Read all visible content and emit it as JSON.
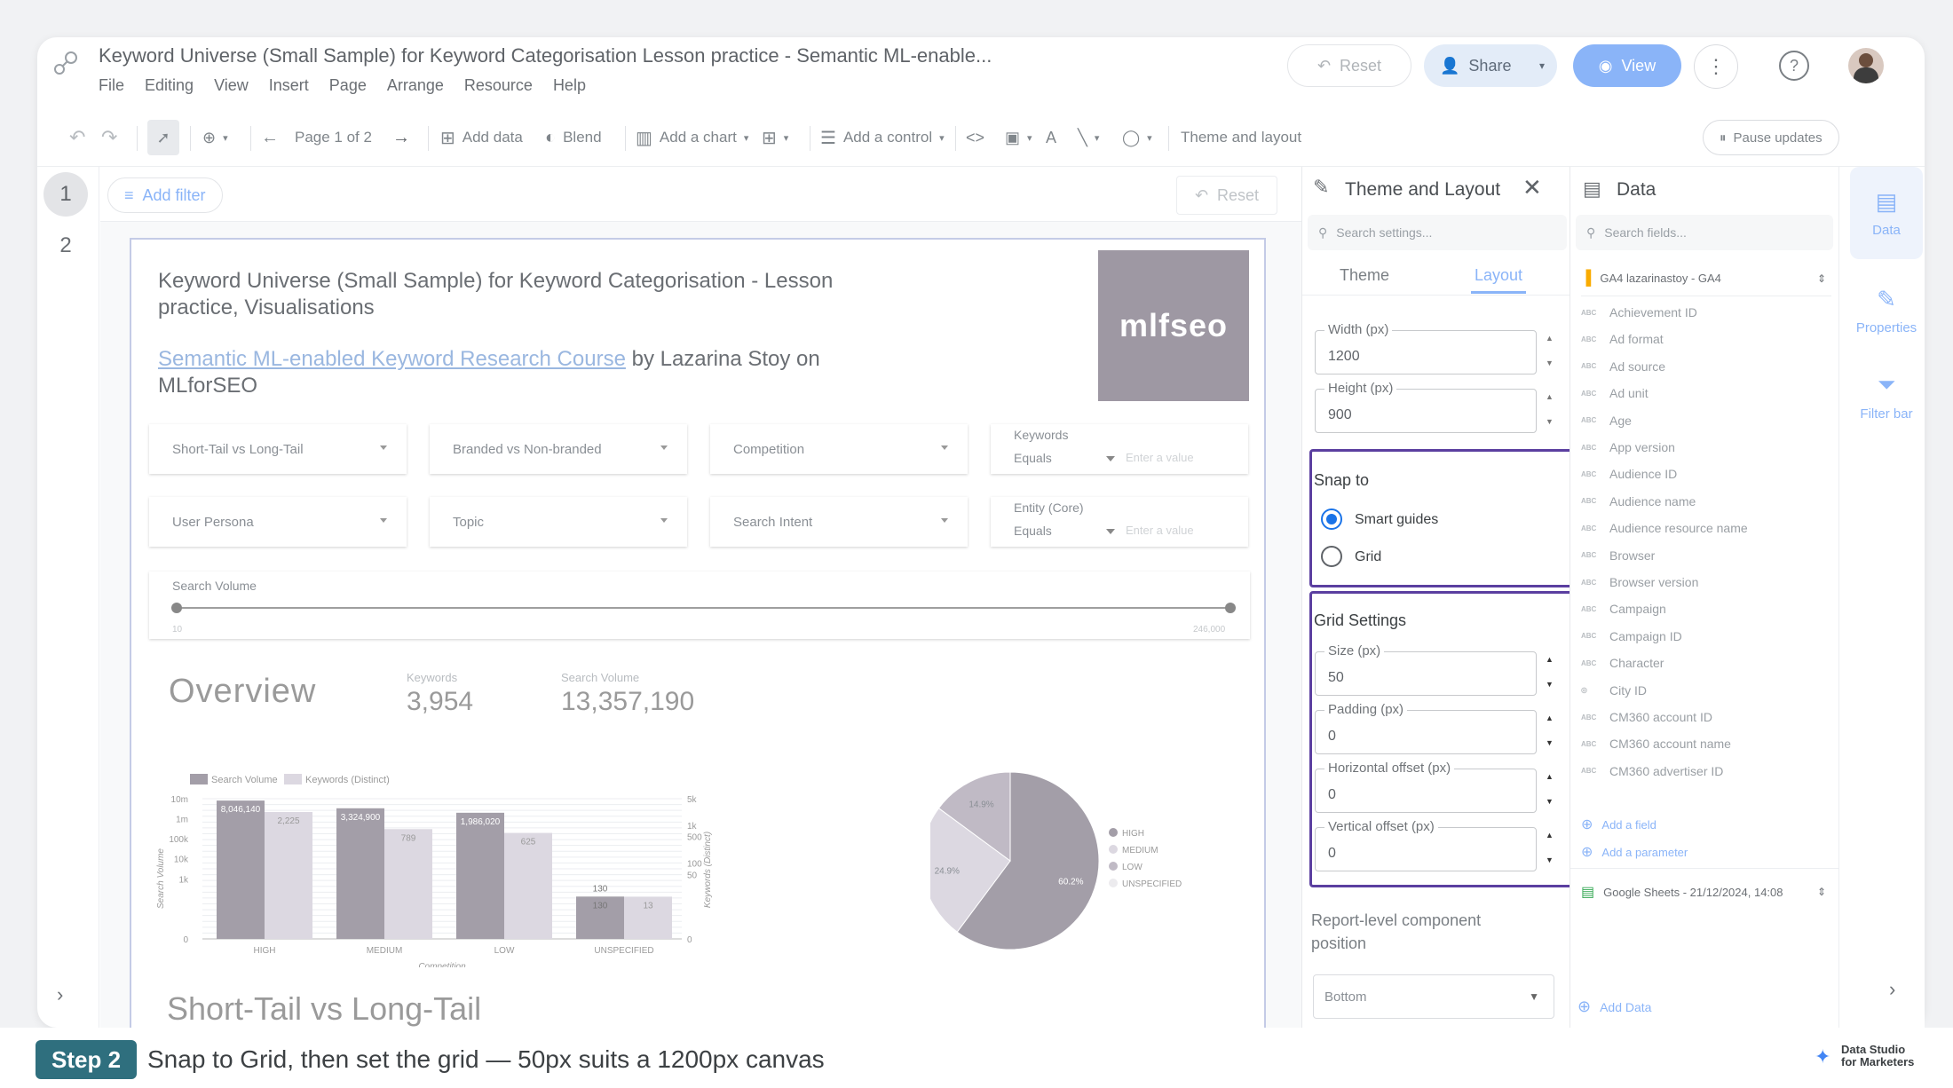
{
  "window": {
    "title": "Keyword Universe (Small Sample) for Keyword Categorisation Lesson practice - Semantic ML-enable...",
    "menu": [
      "File",
      "Editing",
      "View",
      "Insert",
      "Page",
      "Arrange",
      "Resource",
      "Help"
    ],
    "reset_label": "Reset",
    "share_label": "Share",
    "view_label": "View"
  },
  "toolbar": {
    "page_label": "Page 1 of 2",
    "add_data": "Add data",
    "blend": "Blend",
    "add_chart": "Add a chart",
    "add_control": "Add a control",
    "theme_layout": "Theme and layout",
    "pause_updates": "Pause updates"
  },
  "pages": [
    "1",
    "2"
  ],
  "filterbar": {
    "add_filter": "Add filter",
    "reset": "Reset"
  },
  "report": {
    "title": "Keyword Universe (Small Sample) for Keyword Categorisation - Lesson practice, Visualisations",
    "link_text": "Semantic ML-enabled Keyword Research Course",
    "byline_rest": " by Lazarina Stoy on MLforSEO",
    "logo_text": "mlfseo",
    "controls": {
      "short_tail": "Short-Tail vs Long-Tail",
      "branded": "Branded vs Non-branded",
      "competition": "Competition",
      "keywords_label": "Keywords",
      "equals": "Equals",
      "enter_value": "Enter a value",
      "user_persona": "User Persona",
      "topic": "Topic",
      "search_intent": "Search Intent",
      "entity_label": "Entity (Core)",
      "search_volume_label": "Search Volume",
      "slider_min": "10",
      "slider_max": "246,000"
    },
    "overview_title": "Overview",
    "kpis": [
      {
        "label": "Keywords",
        "value": "3,954"
      },
      {
        "label": "Search Volume",
        "value": "13,357,190"
      }
    ],
    "section2_title": "Short-Tail vs Long-Tail"
  },
  "chart_data": [
    {
      "type": "bar",
      "categories": [
        "HIGH",
        "MEDIUM",
        "LOW",
        "UNSPECIFIED"
      ],
      "series": [
        {
          "name": "Search Volume",
          "values": [
            8046140,
            3324900,
            1986020,
            130
          ],
          "labels": [
            "8,046,140",
            "3,324,900",
            "1,986,020",
            "130"
          ]
        },
        {
          "name": "Keywords (Distinct)",
          "values": [
            2225,
            789,
            625,
            13
          ],
          "labels": [
            "2,225",
            "789",
            "625",
            "13"
          ]
        }
      ],
      "xlabel": "Competition",
      "ylabel": "Search Volume",
      "y2label": "Keywords (Distinct)",
      "y_ticks": [
        "10m",
        "1m",
        "100k",
        "10k",
        "1k",
        "0"
      ],
      "y2_ticks": [
        "5k",
        "1k",
        "500",
        "100",
        "50",
        "0"
      ],
      "y_scale": "log",
      "legend": "top-left"
    },
    {
      "type": "pie",
      "labels": [
        "HIGH",
        "MEDIUM",
        "LOW",
        "UNSPECIFIED"
      ],
      "values": [
        60.2,
        24.9,
        14.9,
        0
      ],
      "slice_labels": [
        "60.2%",
        "24.9%",
        "14.9%",
        ""
      ],
      "legend": "right"
    }
  ],
  "theme_panel": {
    "title": "Theme and Layout",
    "search_placeholder": "Search settings...",
    "tabs": [
      "Theme",
      "Layout"
    ],
    "width_label": "Width (px)",
    "width_value": "1200",
    "height_label": "Height (px)",
    "height_value": "900",
    "snap_title": "Snap to",
    "snap_options": [
      "Smart guides",
      "Grid"
    ],
    "grid_title": "Grid Settings",
    "grid_fields": [
      {
        "label": "Size (px)",
        "value": "50"
      },
      {
        "label": "Padding (px)",
        "value": "0"
      },
      {
        "label": "Horizontal offset (px)",
        "value": "0"
      },
      {
        "label": "Vertical offset (px)",
        "value": "0"
      }
    ],
    "position_label": "Report-level component position",
    "position_value": "Bottom"
  },
  "data_panel": {
    "title": "Data",
    "search_placeholder": "Search fields...",
    "source": "GA4 lazarinastoy - GA4",
    "fields": [
      "Achievement ID",
      "Ad format",
      "Ad source",
      "Ad unit",
      "Age",
      "App version",
      "Audience ID",
      "Audience name",
      "Audience resource name",
      "Browser",
      "Browser version",
      "Campaign",
      "Campaign ID",
      "Character",
      "City ID",
      "CM360 account ID",
      "CM360 account name",
      "CM360 advertiser ID"
    ],
    "add_field": "Add a field",
    "add_parameter": "Add a parameter",
    "source2": "Google Sheets - 21/12/2024, 14:08",
    "add_data": "Add Data"
  },
  "right_tabs": [
    "Data",
    "Properties",
    "Filter bar"
  ],
  "footer": {
    "step": "Step 2",
    "caption": "Snap to Grid, then set the grid — 50px suits a 1200px canvas",
    "brand_line1": "Data Studio",
    "brand_line2": "for Marketers"
  },
  "colors": {
    "accent": "#1a73e8",
    "highlight": "#5b3fa0",
    "bar1": "#a39ea8",
    "bar2": "#dcd8e1",
    "step_bg": "#2f6f7e"
  }
}
